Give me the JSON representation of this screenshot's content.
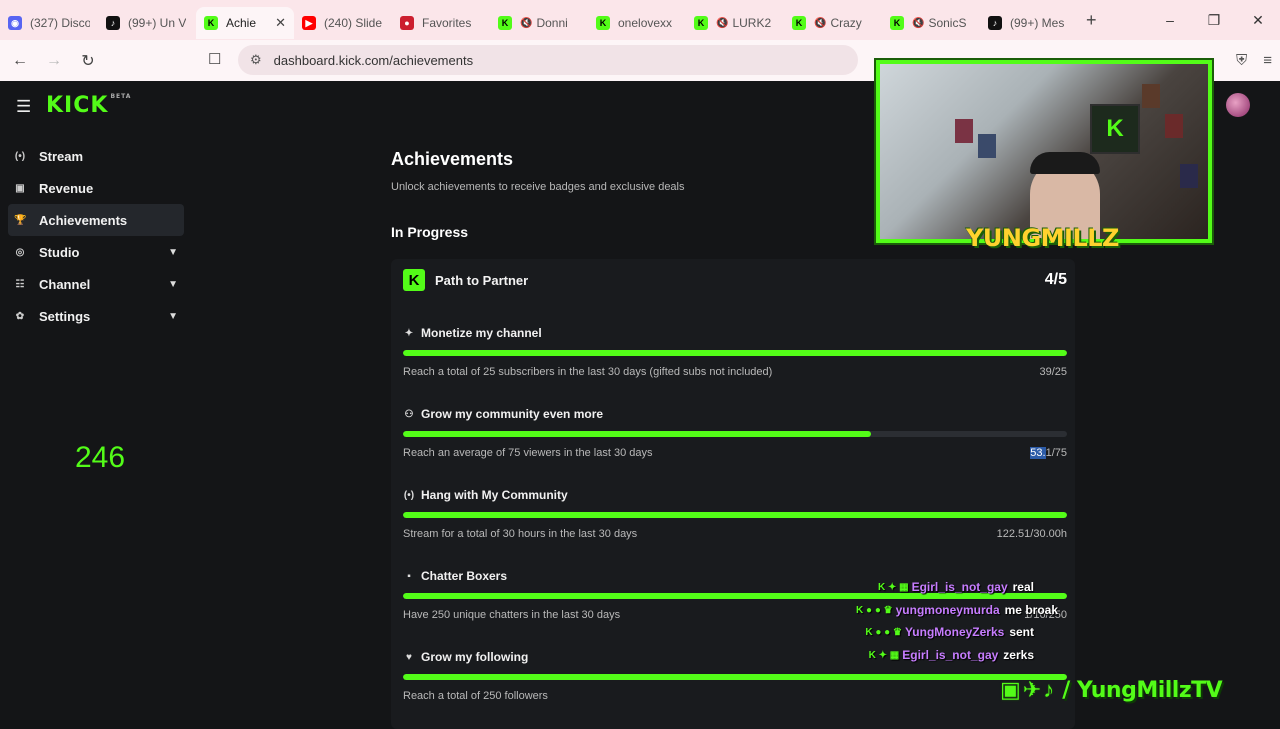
{
  "browser": {
    "tabs": [
      {
        "title": "(327) Disco",
        "favicon": "discord-icon",
        "color": "#5865f2",
        "muted": false,
        "active": false
      },
      {
        "title": "(99+) Un V",
        "favicon": "tiktok-icon",
        "color": "#111111",
        "muted": false,
        "active": false
      },
      {
        "title": "Achie",
        "favicon": "kick-icon",
        "color": "#53fc18",
        "muted": false,
        "active": true
      },
      {
        "title": "(240) Slide",
        "favicon": "youtube-icon",
        "color": "#ff0000",
        "muted": false,
        "active": false
      },
      {
        "title": "Favorites",
        "favicon": "record-icon",
        "color": "#cc1f2f",
        "muted": false,
        "active": false
      },
      {
        "title": "Donni",
        "favicon": "kick-icon",
        "color": "#53fc18",
        "muted": true,
        "active": false
      },
      {
        "title": "onelovexx",
        "favicon": "kick-icon",
        "color": "#53fc18",
        "muted": false,
        "active": false
      },
      {
        "title": "LURK2",
        "favicon": "kick-icon",
        "color": "#53fc18",
        "muted": true,
        "active": false
      },
      {
        "title": "Crazy",
        "favicon": "kick-icon",
        "color": "#53fc18",
        "muted": true,
        "active": false
      },
      {
        "title": "SonicS",
        "favicon": "kick-icon",
        "color": "#53fc18",
        "muted": true,
        "active": false
      },
      {
        "title": "(99+) Mes",
        "favicon": "tiktok-icon",
        "color": "#111111",
        "muted": false,
        "active": false
      }
    ],
    "url": "dashboard.kick.com/achievements"
  },
  "kick": {
    "logo": "KICK",
    "logo_beta": "BETA",
    "sidebar": [
      {
        "label": "Stream",
        "icon": "broadcast-icon",
        "expandable": false,
        "active": false
      },
      {
        "label": "Revenue",
        "icon": "revenue-icon",
        "expandable": false,
        "active": false
      },
      {
        "label": "Achievements",
        "icon": "trophy-icon",
        "expandable": false,
        "active": true
      },
      {
        "label": "Studio",
        "icon": "studio-icon",
        "expandable": true,
        "active": false
      },
      {
        "label": "Channel",
        "icon": "channel-icon",
        "expandable": true,
        "active": false
      },
      {
        "label": "Settings",
        "icon": "gear-icon",
        "expandable": true,
        "active": false
      }
    ],
    "overlay_counter": "246",
    "page_title": "Achievements",
    "page_subtitle": "Unlock achievements to receive badges and exclusive deals",
    "section_title": "In Progress",
    "card": {
      "title": "Path to Partner",
      "count": "4/5",
      "achievements": [
        {
          "title": "Monetize my channel",
          "icon": "sparkle-icon",
          "description": "Reach a total of 25 subscribers in the last 30 days (gifted subs not included)",
          "value": "39/25",
          "progress": 1.0
        },
        {
          "title": "Grow my community even more",
          "icon": "community-icon",
          "description": "Reach an average of 75 viewers in the last 30 days",
          "value_highlight": "53.",
          "value_rest": "1/75",
          "progress": 0.705
        },
        {
          "title": "Hang with My Community",
          "icon": "broadcast-icon",
          "description": "Stream for a total of 30 hours in the last 30 days",
          "value": "122.51/30.00h",
          "progress": 1.0
        },
        {
          "title": "Chatter Boxers",
          "icon": "chat-icon",
          "description": "Have 250 unique chatters in the last 30 days",
          "value": "1/16/250",
          "progress": 1.0
        },
        {
          "title": "Grow my following",
          "icon": "heart-icon",
          "description": "Reach a total of 250 followers",
          "value": "",
          "progress": 1.0
        }
      ]
    }
  },
  "stream_overlay": {
    "webcam_name": "YUNGMILLZ",
    "webcam_plaque": "K",
    "social_handle": "/ YungMillzTV",
    "chat": [
      {
        "badges": "K ✦ ▦",
        "user": "Egirl_is_not_gay",
        "user_color": "#c77dff",
        "message": "real"
      },
      {
        "badges": "K ● ● ♛",
        "user": "yungmoneymurda",
        "user_color": "#c77dff",
        "message": "me broak"
      },
      {
        "badges": "K ● ● ♛",
        "user": "YungMoneyZerks",
        "user_color": "#c77dff",
        "message": "sent"
      },
      {
        "badges": "K ✦ ▦",
        "user": "Egirl_is_not_gay",
        "user_color": "#c77dff",
        "message": "zerks"
      }
    ]
  }
}
